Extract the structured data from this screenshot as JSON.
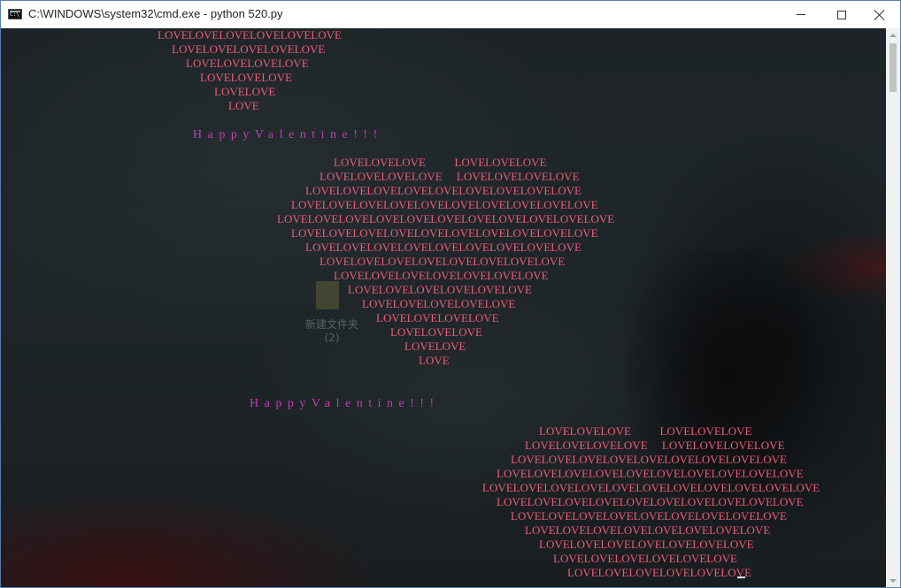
{
  "window": {
    "title": "C:\\WINDOWS\\system32\\cmd.exe - python  520.py",
    "icon": "cmd-icon",
    "controls": [
      "minimize-icon",
      "maximize-icon",
      "close-icon"
    ]
  },
  "colors": {
    "love_text": "#ef5b7a",
    "happy_text": "#c23cb6",
    "titlebar_bg": "#ffffff"
  },
  "desktop_icon": {
    "label": "新建文件夹\n(2)"
  },
  "heart1_tail": [
    "LOVELOVELOVELOVELOVELOVE",
    "LOVELOVELOVELOVELOVE",
    "LOVELOVELOVELOVE",
    "LOVELOVELOVE",
    "LOVELOVE",
    "LOVE"
  ],
  "happy_1": "HappyValentine!!!",
  "heart2": [
    "LOVELOVELOVE          LOVELOVELOVE",
    "LOVELOVELOVELOVE     LOVELOVELOVELOVE",
    "LOVELOVELOVELOVELOVELOVELOVELOVELOVE",
    "LOVELOVELOVELOVELOVELOVELOVELOVELOVELOVE",
    "LOVELOVELOVELOVELOVELOVELOVELOVELOVELOVELOVE",
    "LOVELOVELOVELOVELOVELOVELOVELOVELOVELOVE",
    "LOVELOVELOVELOVELOVELOVELOVELOVELOVE",
    "LOVELOVELOVELOVELOVELOVELOVELOVE",
    "LOVELOVELOVELOVELOVELOVELOVE",
    "LOVELOVELOVELOVELOVELOVE",
    "LOVELOVELOVELOVELOVE",
    "LOVELOVELOVELOVE",
    "LOVELOVELOVE",
    "LOVELOVE",
    "LOVE"
  ],
  "happy_2": "HappyValentine!!!",
  "heart3": [
    "LOVELOVELOVE          LOVELOVELOVE",
    "LOVELOVELOVELOVE     LOVELOVELOVELOVE",
    "LOVELOVELOVELOVELOVELOVELOVELOVELOVE",
    "LOVELOVELOVELOVELOVELOVELOVELOVELOVELOVE",
    "LOVELOVELOVELOVELOVELOVELOVELOVELOVELOVELOVE",
    "LOVELOVELOVELOVELOVELOVELOVELOVELOVELOVE",
    "LOVELOVELOVELOVELOVELOVELOVELOVELOVE",
    "LOVELOVELOVELOVELOVELOVELOVELOVE",
    "LOVELOVELOVELOVELOVELOVELOVE",
    "LOVELOVELOVELOVELOVELOVE",
    "LOVELOVELOVELOVELOVELOVE"
  ]
}
